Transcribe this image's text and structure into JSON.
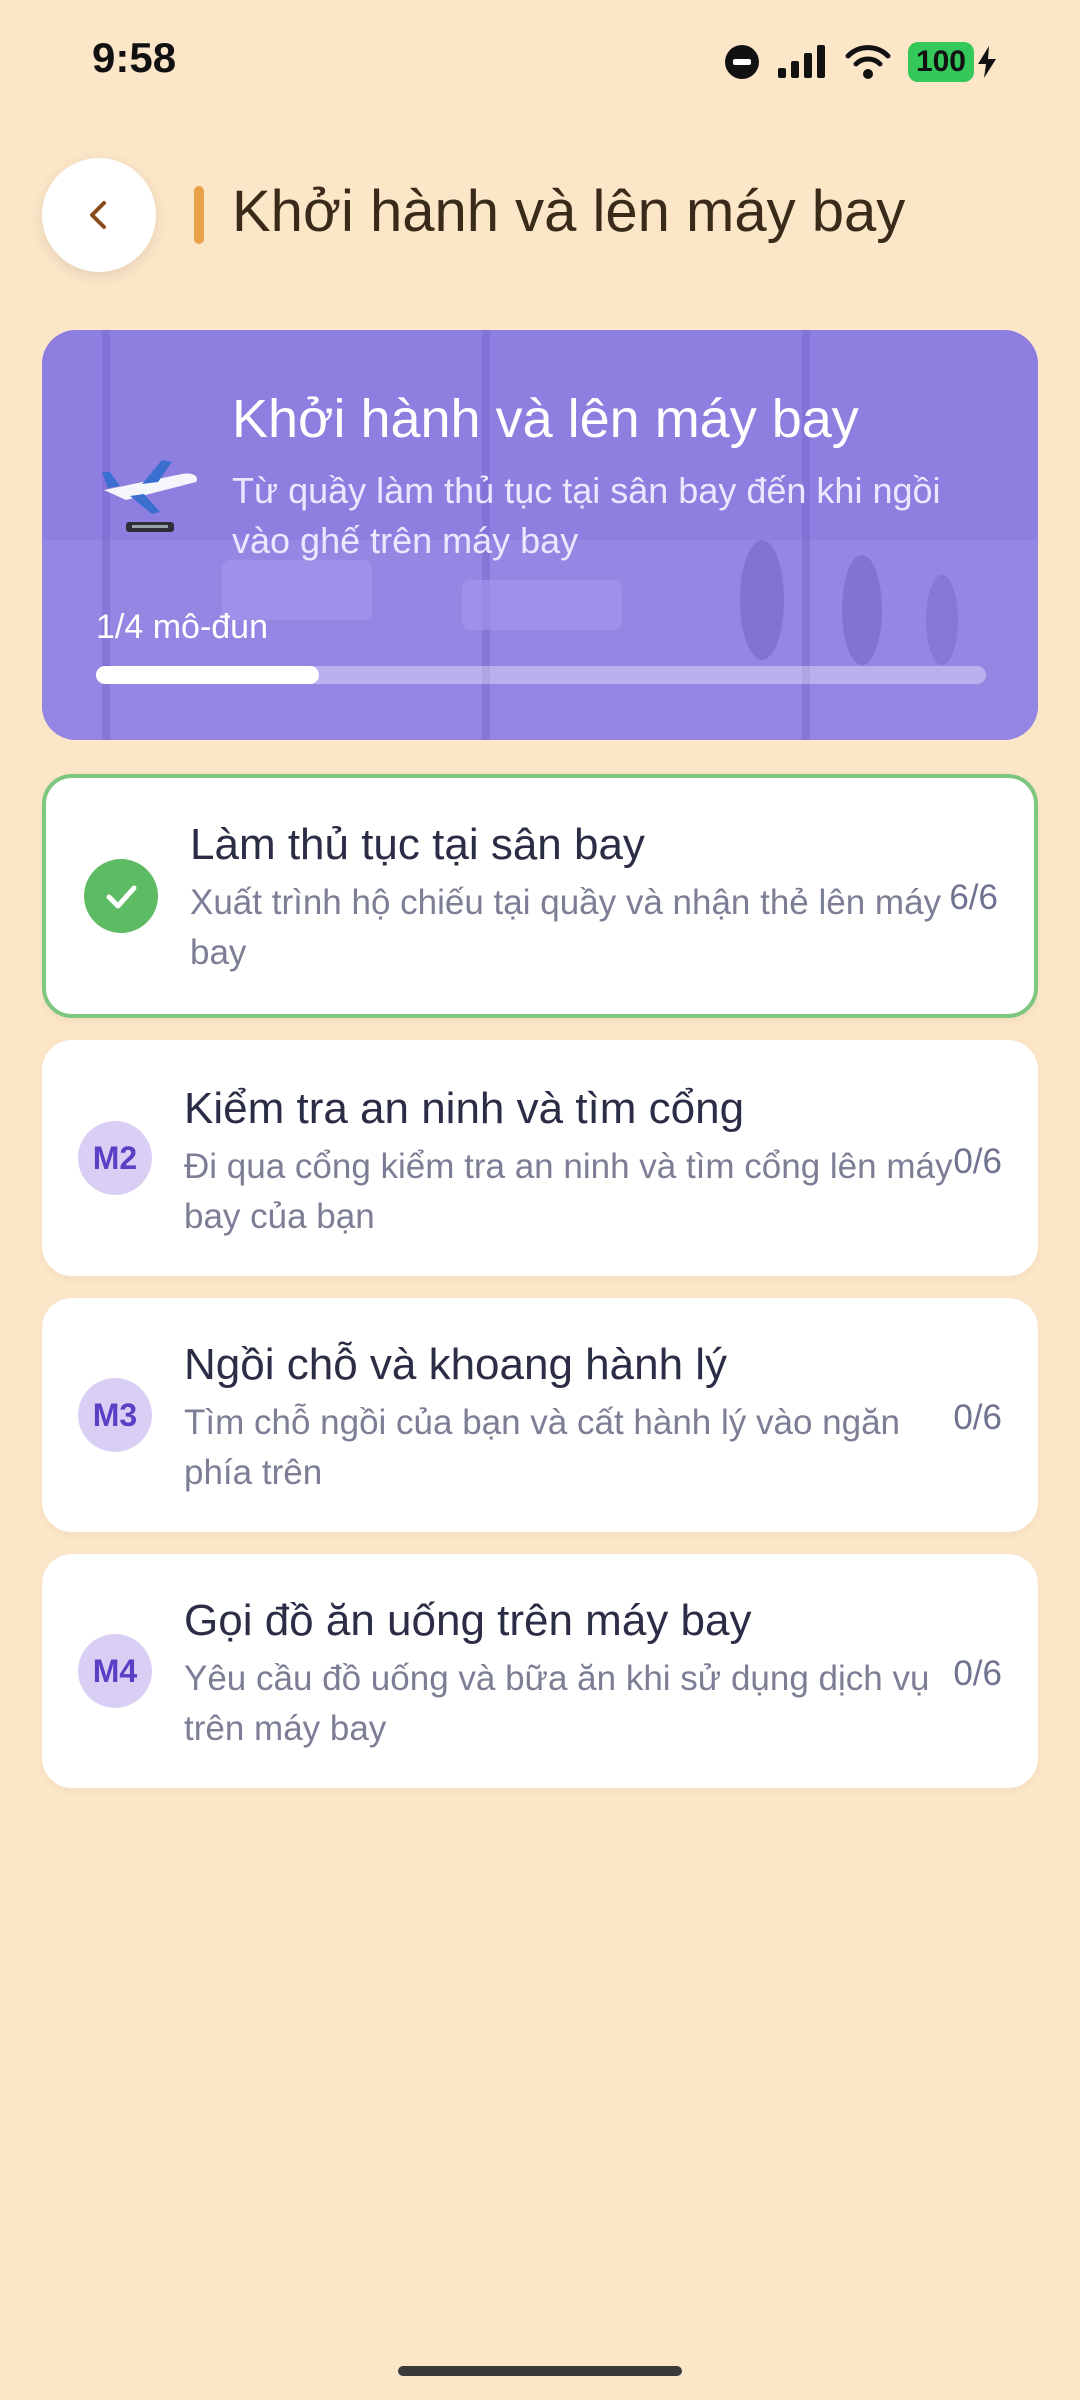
{
  "status_bar": {
    "time": "9:58",
    "battery": "100"
  },
  "header": {
    "title": "Khởi hành và lên máy bay"
  },
  "hero": {
    "title": "Khởi hành và lên máy bay",
    "subtitle": "Từ quầy làm thủ tục tại sân bay đến khi ngồi vào ghế trên máy bay",
    "progress_label": "1/4 mô-đun",
    "progress_fraction": 0.25
  },
  "modules": [
    {
      "badge": "",
      "completed": true,
      "title": "Làm thủ tục tại sân bay",
      "description": "Xuất trình hộ chiếu tại quầy và nhận thẻ lên máy bay",
      "progress": "6/6"
    },
    {
      "badge": "M2",
      "completed": false,
      "title": "Kiểm tra an ninh và tìm cổng",
      "description": "Đi qua cổng kiểm tra an ninh và tìm cổng lên máy bay của bạn",
      "progress": "0/6"
    },
    {
      "badge": "M3",
      "completed": false,
      "title": "Ngồi chỗ và khoang hành lý",
      "description": "Tìm chỗ ngồi của bạn và cất hành lý vào ngăn phía trên",
      "progress": "0/6"
    },
    {
      "badge": "M4",
      "completed": false,
      "title": "Gọi đồ ăn uống trên máy bay",
      "description": "Yêu cầu đồ uống và bữa ăn khi sử dụng dịch vụ trên máy bay",
      "progress": "0/6"
    }
  ],
  "colors": {
    "background": "#FCE6C8",
    "accent": "#E8A24A",
    "hero": "#9B89E8",
    "done": "#5DBB63",
    "badge": "#D9CFF5"
  }
}
